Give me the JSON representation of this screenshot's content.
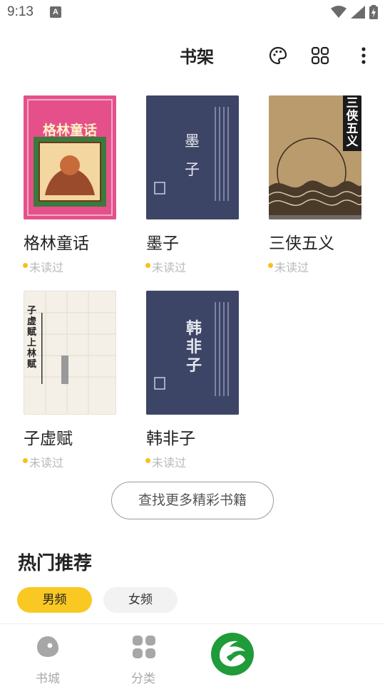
{
  "status_bar": {
    "time": "9:13",
    "notification_icon": "a-letter-icon",
    "icons": [
      "wifi-icon",
      "signal-icon",
      "battery-charging-icon"
    ]
  },
  "header": {
    "title": "书架",
    "icons": [
      "palette-icon",
      "grid-icon",
      "more-vert-icon"
    ]
  },
  "books": [
    {
      "title": "格林童话",
      "status": "未读过",
      "cover_text": "格林童话"
    },
    {
      "title": "墨子",
      "status": "未读过",
      "cover_text": "墨 子"
    },
    {
      "title": "三侠五义",
      "status": "未读过",
      "cover_text": "三侠五义"
    },
    {
      "title": "子虚赋",
      "status": "未读过",
      "cover_text": "子虚赋 上林赋"
    },
    {
      "title": "韩非子",
      "status": "未读过",
      "cover_text": "韩非子"
    }
  ],
  "find_more_label": "查找更多精彩书籍",
  "hot": {
    "title": "热门推荐",
    "tabs": [
      {
        "label": "男频",
        "selected": true
      },
      {
        "label": "女频",
        "selected": false
      }
    ]
  },
  "bottom_nav": {
    "items": [
      {
        "label": "书城",
        "icon": "store-icon"
      },
      {
        "label": "分类",
        "icon": "category-icon"
      },
      {
        "label": "",
        "icon": "app-logo-icon"
      }
    ]
  },
  "colors": {
    "accent": "#f9c823",
    "unread_dot": "#f6c21a",
    "logo_green": "#1f9b3a"
  }
}
